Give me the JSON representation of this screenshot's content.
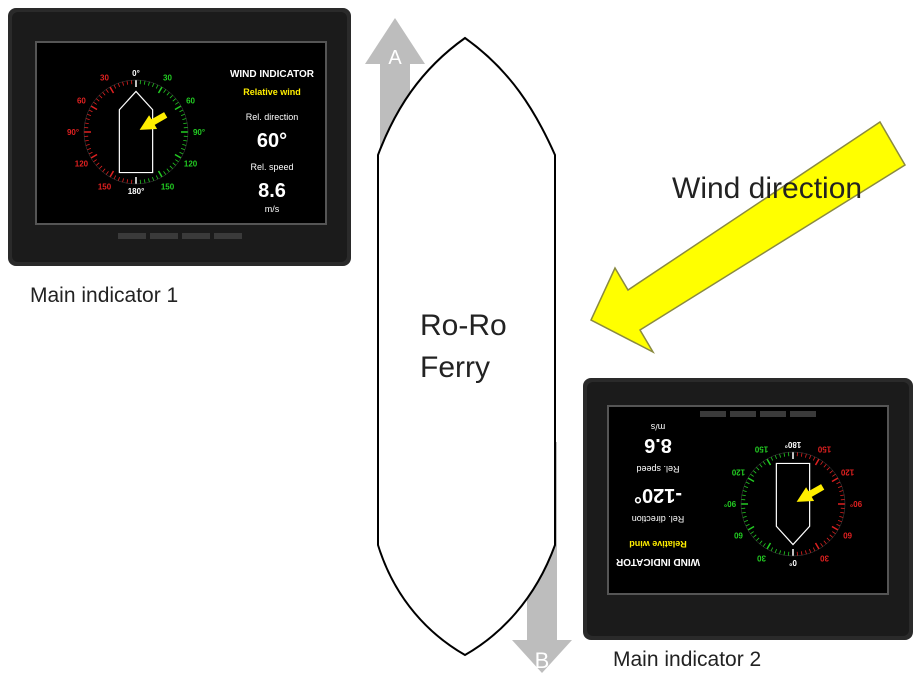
{
  "ship": {
    "line1": "Ro-Ro",
    "line2": "Ferry"
  },
  "arrows": {
    "forward_label": "A",
    "aft_label": "B",
    "wind_label": "Wind direction",
    "wind_color": "#ffff00"
  },
  "indicator1": {
    "caption": "Main indicator 1",
    "title": "WIND INDICATOR",
    "subtitle": "Relative wind",
    "dir_label": "Rel. direction",
    "dir_value": "60°",
    "speed_label": "Rel. speed",
    "speed_value": "8.6",
    "speed_unit": "m/s",
    "wind_angle_deg": 60
  },
  "indicator2": {
    "caption": "Main indicator 2",
    "title": "WIND INDICATOR",
    "subtitle": "Relative wind",
    "dir_label": "Rel. direction",
    "dir_value": "-120°",
    "speed_label": "Rel. speed",
    "speed_value": "8.6",
    "speed_unit": "m/s",
    "wind_angle_deg": -120
  },
  "dial": {
    "top": "0°",
    "bottom": "180°",
    "port": [
      "30",
      "60",
      "90°",
      "120",
      "150"
    ],
    "starboard": [
      "30",
      "60",
      "90°",
      "120",
      "150"
    ],
    "port_color": "#e02020",
    "starboard_color": "#22cc22",
    "subtitle_color": "#ffee00"
  }
}
